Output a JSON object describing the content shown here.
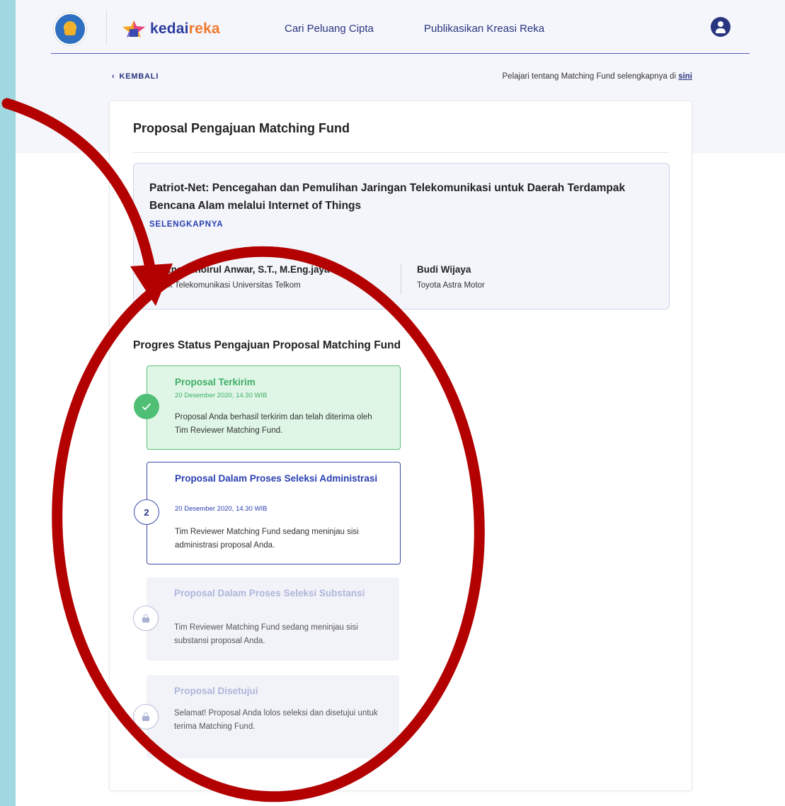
{
  "header": {
    "brand_part1": "kedai",
    "brand_part2": "reka",
    "nav": [
      "Cari Peluang Cipta",
      "Publikasikan Kreasi Reka"
    ]
  },
  "subnav": {
    "back_label": "KEMBALI",
    "learn_text": "Pelajari tentang Matching Fund selengkapnya di ",
    "learn_link": "sini"
  },
  "card": {
    "title": "Proposal Pengajuan Matching Fund",
    "project": {
      "title": "Patriot-Net: Pencegahan dan Pemulihan Jaringan Telekomunikasi untuk Daerah Terdampak Bencana Alam melalui Internet of Things",
      "more_label": "SELENGKAPNYA",
      "person1_name": "Dr. Eng. Khoirul Anwar, S.T., M.Eng.jaya",
      "person1_org": "Teknik Telekomunikasi Universitas Telkom",
      "person2_name": "Budi Wijaya",
      "person2_org": "Toyota Astra Motor"
    },
    "progress_title": "Progres Status Pengajuan Proposal Matching Fund",
    "steps": [
      {
        "title": "Proposal Terkirim",
        "date": "20 Desember 2020, 14.30 WIB",
        "desc": "Proposal Anda berhasil terkirim dan telah diterima oleh Tim Reviewer Matching Fund.",
        "state": "done"
      },
      {
        "number": "2",
        "title": "Proposal Dalam Proses Seleksi Administrasi",
        "date": "20 Desember 2020, 14.30 WIB",
        "desc": "Tim Reviewer Matching Fund sedang meninjau sisi administrasi proposal Anda.",
        "state": "active"
      },
      {
        "title": "Proposal Dalam Proses Seleksi Substansi",
        "desc": "Tim Reviewer Matching Fund sedang meninjau sisi substansi proposal Anda.",
        "state": "locked"
      },
      {
        "title": "Proposal Disetujui",
        "desc": "Selamat! Proposal Anda lolos seleksi dan disetujui untuk terima Matching Fund.",
        "state": "locked"
      }
    ]
  },
  "colors": {
    "brand_blue": "#2a3b9e",
    "brand_orange": "#f07a2e",
    "success_green": "#4fbf75",
    "annotation_red": "#b30000",
    "outer_background": "#9fd8e0"
  }
}
